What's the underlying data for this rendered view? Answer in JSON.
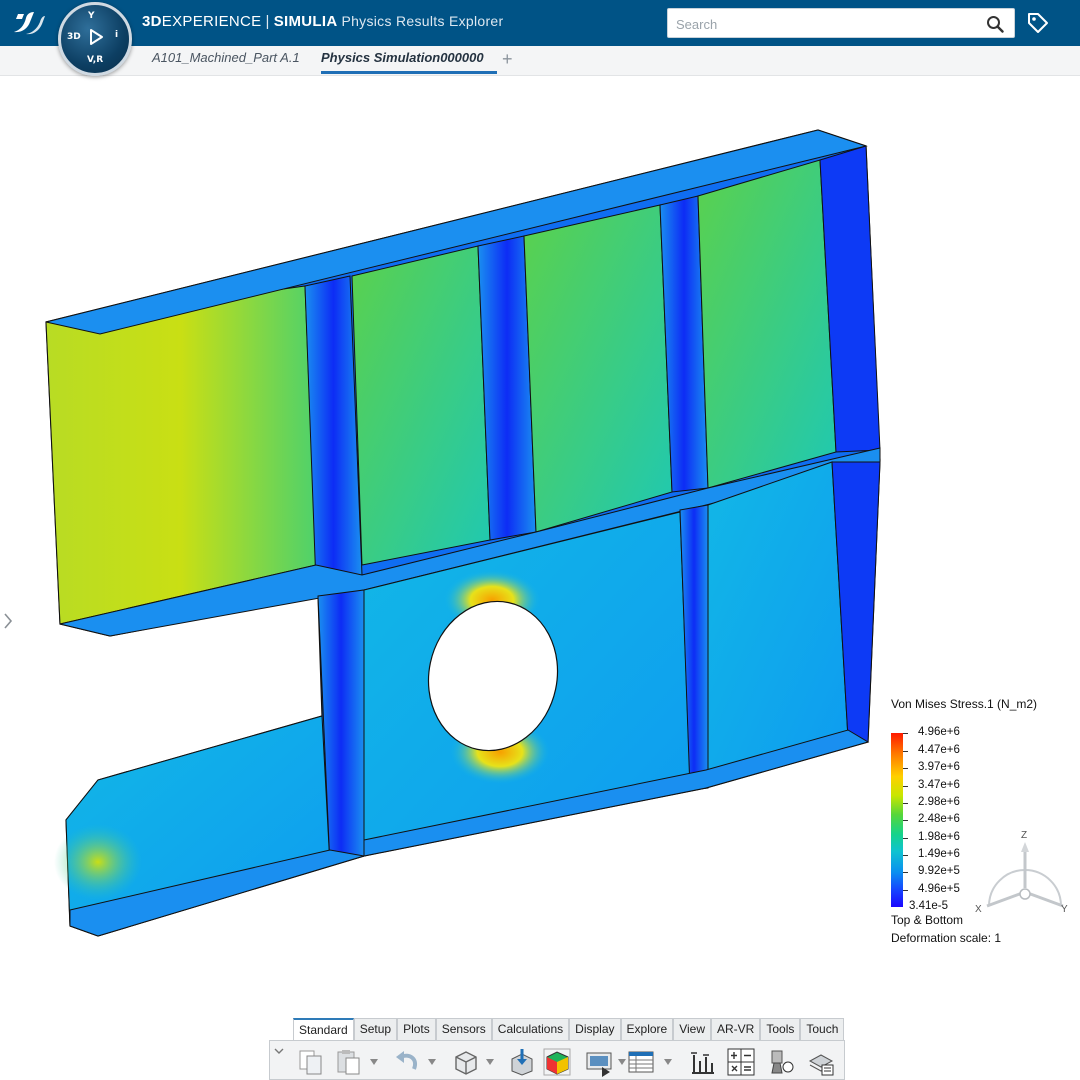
{
  "header": {
    "brand_bold": "3D",
    "brand": "EXPERIENCE",
    "separator": "|",
    "product": "SIMULIA",
    "app_name": "Physics Results Explorer",
    "compass_labels": {
      "top": "V,R",
      "left": "3D",
      "right": "i",
      "bottom_small": "Y"
    }
  },
  "search": {
    "placeholder": "Search",
    "value": ""
  },
  "tabs": [
    {
      "label": "A101_Machined_Part A.1",
      "active": false
    },
    {
      "label": "Physics Simulation000000",
      "active": true
    }
  ],
  "tab_add": "+",
  "legend": {
    "title": "Von Mises Stress.1 (N_m2)",
    "values": [
      "4.96e+6",
      "4.47e+6",
      "3.97e+6",
      "3.47e+6",
      "2.98e+6",
      "2.48e+6",
      "1.98e+6",
      "1.49e+6",
      "9.92e+5",
      "4.96e+5",
      "3.41e-5"
    ],
    "note1": "Top & Bottom",
    "note2": "Deformation scale: 1"
  },
  "triad": {
    "z": "Z",
    "x": "X",
    "y": "Y"
  },
  "toolbar": {
    "tabs": [
      {
        "label": "Standard",
        "active": true
      },
      {
        "label": "Setup",
        "active": false
      },
      {
        "label": "Plots",
        "active": false
      },
      {
        "label": "Sensors",
        "active": false
      },
      {
        "label": "Calculations",
        "active": false
      },
      {
        "label": "Display",
        "active": false
      },
      {
        "label": "Explore",
        "active": false
      },
      {
        "label": "View",
        "active": false
      },
      {
        "label": "AR-VR",
        "active": false
      },
      {
        "label": "Tools",
        "active": false
      },
      {
        "label": "Touch",
        "active": false
      }
    ],
    "icons": [
      "copy-icon",
      "paste-icon",
      "undo-icon",
      "view-box-icon",
      "export-icon",
      "contour-plot-icon",
      "animation-icon",
      "table-icon",
      "sensor-icon",
      "calculator-icon",
      "probe-icon",
      "layers-icon"
    ]
  },
  "colors": {
    "header": "#005386",
    "accent": "#1f6fb6"
  }
}
